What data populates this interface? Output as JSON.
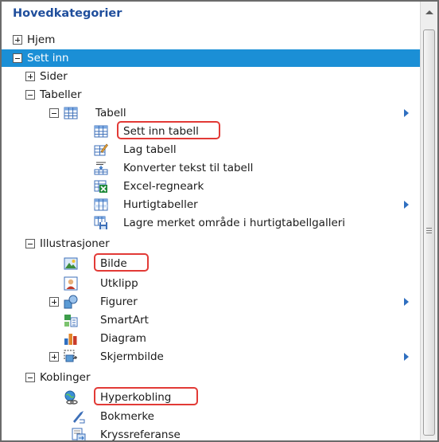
{
  "panel": {
    "title": "Hovedkategorier"
  },
  "tree": {
    "hjem": "Hjem",
    "sett_inn": "Sett inn",
    "sider": "Sider",
    "tabeller": "Tabeller",
    "tabell": "Tabell",
    "sett_inn_tabell": "Sett inn tabell",
    "lag_tabell": "Lag tabell",
    "konverter": "Konverter tekst til tabell",
    "excel": "Excel-regneark",
    "hurtigtabeller": "Hurtigtabeller",
    "lagre_merket": "Lagre merket område i hurtigtabellgalleri",
    "illustrasjoner": "Illustrasjoner",
    "bilde": "Bilde",
    "utklipp": "Utklipp",
    "figurer": "Figurer",
    "smartart": "SmartArt",
    "diagram": "Diagram",
    "skjermbilde": "Skjermbilde",
    "koblinger": "Koblinger",
    "hyperkobling": "Hyperkobling",
    "bokmerke": "Bokmerke",
    "kryssreferanse": "Kryssreferanse"
  },
  "colors": {
    "selection": "#1b8fd6",
    "header_text": "#1f4e9c",
    "highlight_border": "#e23a36",
    "submenu_arrow": "#2f6fc0"
  },
  "icons": {
    "tabell": "table-icon",
    "sett_inn_tabell": "insert-table-icon",
    "lag_tabell": "draw-table-icon",
    "konverter": "convert-text-to-table-icon",
    "excel": "excel-spreadsheet-icon",
    "hurtigtabeller": "quick-tables-icon",
    "lagre_merket": "save-selection-to-gallery-icon",
    "bilde": "picture-icon",
    "utklipp": "clip-art-icon",
    "figurer": "shapes-icon",
    "smartart": "smartart-icon",
    "diagram": "chart-icon",
    "skjermbilde": "screenshot-icon",
    "hyperkobling": "hyperlink-icon",
    "bokmerke": "bookmark-icon",
    "kryssreferanse": "cross-reference-icon"
  }
}
